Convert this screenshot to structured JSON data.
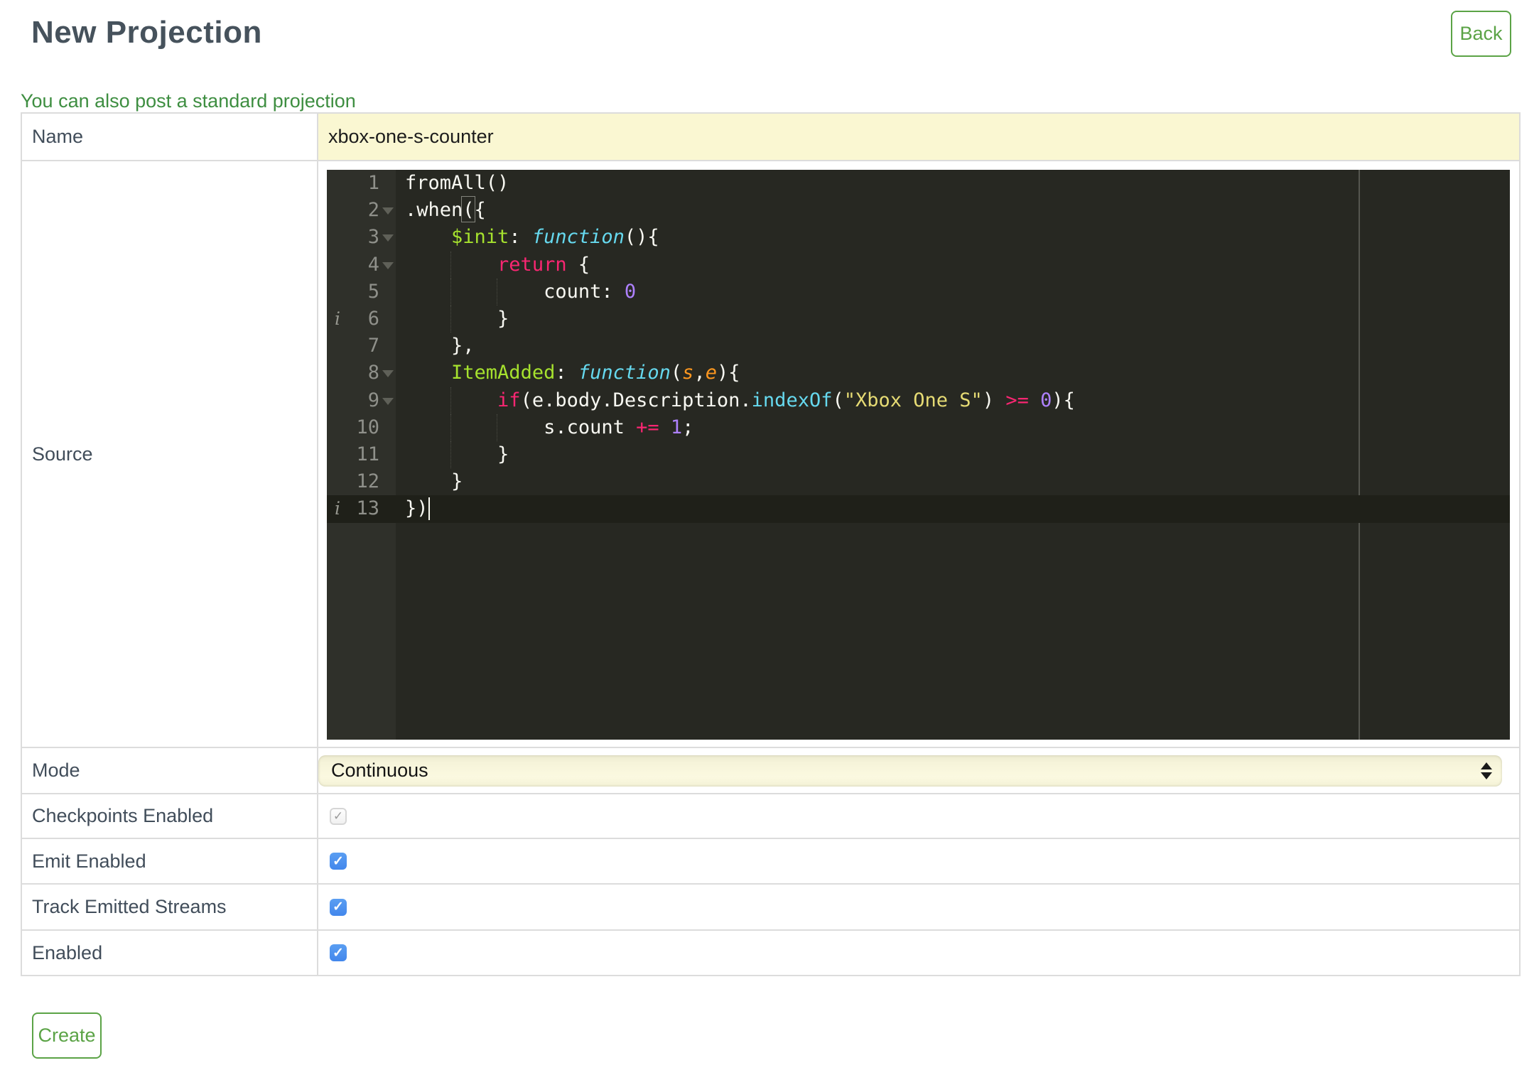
{
  "page": {
    "title": "New Projection",
    "back_label": "Back",
    "link_text": "You can also post a standard projection",
    "create_label": "Create"
  },
  "form": {
    "name": {
      "label": "Name",
      "value": "xbox-one-s-counter"
    },
    "source": {
      "label": "Source"
    },
    "mode": {
      "label": "Mode",
      "value": "Continuous"
    },
    "checkpoints": {
      "label": "Checkpoints Enabled",
      "checked": true,
      "disabled": true
    },
    "emit": {
      "label": "Emit Enabled",
      "checked": true,
      "disabled": false
    },
    "track": {
      "label": "Track Emitted Streams",
      "checked": true,
      "disabled": false
    },
    "enabled": {
      "label": "Enabled",
      "checked": true,
      "disabled": false
    }
  },
  "editor": {
    "active_line": 13,
    "cursor": {
      "line": 13,
      "col": 2
    },
    "lines": [
      {
        "num": 1,
        "fold": false,
        "info": false,
        "tokens": [
          [
            "p",
            "fromAll()"
          ]
        ]
      },
      {
        "num": 2,
        "fold": true,
        "info": false,
        "tokens": [
          [
            "p",
            ".when"
          ],
          [
            "bx",
            "("
          ],
          [
            "p",
            "{"
          ]
        ]
      },
      {
        "num": 3,
        "fold": true,
        "info": false,
        "tokens": [
          [
            "p",
            "    "
          ],
          [
            "g",
            "$init"
          ],
          [
            "p",
            ": "
          ],
          [
            "f",
            "function"
          ],
          [
            "p",
            "(){"
          ]
        ]
      },
      {
        "num": 4,
        "fold": true,
        "info": false,
        "tokens": [
          [
            "p",
            "        "
          ],
          [
            "k",
            "return"
          ],
          [
            "p",
            " {"
          ]
        ]
      },
      {
        "num": 5,
        "fold": false,
        "info": false,
        "tokens": [
          [
            "p",
            "            count: "
          ],
          [
            "n",
            "0"
          ]
        ]
      },
      {
        "num": 6,
        "fold": false,
        "info": true,
        "tokens": [
          [
            "p",
            "        }"
          ]
        ]
      },
      {
        "num": 7,
        "fold": false,
        "info": false,
        "tokens": [
          [
            "p",
            "    },"
          ]
        ]
      },
      {
        "num": 8,
        "fold": true,
        "info": false,
        "tokens": [
          [
            "p",
            "    "
          ],
          [
            "g",
            "ItemAdded"
          ],
          [
            "p",
            ": "
          ],
          [
            "f",
            "function"
          ],
          [
            "p",
            "("
          ],
          [
            "a",
            "s"
          ],
          [
            "p",
            ","
          ],
          [
            "a",
            "e"
          ],
          [
            "p",
            "){"
          ]
        ]
      },
      {
        "num": 9,
        "fold": true,
        "info": false,
        "tokens": [
          [
            "p",
            "        "
          ],
          [
            "k",
            "if"
          ],
          [
            "p",
            "(e.body.Description."
          ],
          [
            "c",
            "indexOf"
          ],
          [
            "p",
            "("
          ],
          [
            "s",
            "\"Xbox One S\""
          ],
          [
            "p",
            ") "
          ],
          [
            "k",
            ">="
          ],
          [
            "p",
            " "
          ],
          [
            "n",
            "0"
          ],
          [
            "p",
            "){"
          ]
        ]
      },
      {
        "num": 10,
        "fold": false,
        "info": false,
        "tokens": [
          [
            "p",
            "            s.count "
          ],
          [
            "k",
            "+="
          ],
          [
            "p",
            " "
          ],
          [
            "n",
            "1"
          ],
          [
            "p",
            ";"
          ]
        ]
      },
      {
        "num": 11,
        "fold": false,
        "info": false,
        "tokens": [
          [
            "p",
            "        }"
          ]
        ]
      },
      {
        "num": 12,
        "fold": false,
        "info": false,
        "tokens": [
          [
            "p",
            "    }"
          ]
        ]
      },
      {
        "num": 13,
        "fold": false,
        "info": true,
        "tokens": [
          [
            "p",
            "})"
          ]
        ]
      }
    ]
  },
  "colors": {
    "accent_green": "#5ba346",
    "link_green": "#3e8e41",
    "highlight_yellow": "#faf7d2",
    "checkbox_blue": "#4a90ee",
    "table_border": "#dcdcdc",
    "label_text": "#414d5a",
    "title_text": "#46525c",
    "editor_bg": "#272822",
    "editor_gutter_bg": "#2f302a",
    "editor_active_line": "#1f2019",
    "print_margin": "#55564f",
    "mono_plain": "#f8f8f2",
    "mono_keyword": "#f92672",
    "mono_function": "#66d9ef",
    "mono_entity": "#a6e22e",
    "mono_string": "#e6db74",
    "mono_number": "#ae81ff",
    "mono_param": "#fd971f",
    "gutter_text": "#8f908a"
  }
}
